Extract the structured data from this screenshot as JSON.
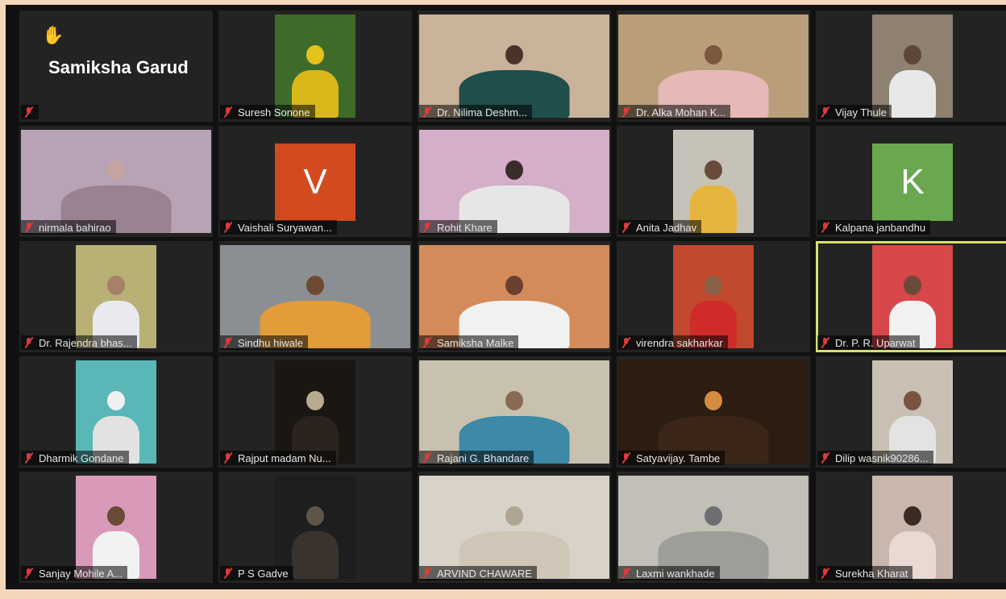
{
  "app": {
    "mic_state": "muted"
  },
  "highlight_color": "#d7e06b",
  "participants": [
    {
      "name": "",
      "big_name": "Samiksha Garud",
      "hand_raised": true,
      "type": "none",
      "active": false
    },
    {
      "name": "Suresh Sonone",
      "type": "video",
      "bg": "#3f6b2a",
      "fig": "#e2c21b",
      "body": "#d8b81a"
    },
    {
      "name": "Dr. Nilima Deshm...",
      "type": "video-wide",
      "bg": "#c9b39a",
      "fig": "#4a332a",
      "body": "#1f4e4b"
    },
    {
      "name": "Dr. Alka Mohan K...",
      "type": "video-wide",
      "bg": "#b89f7a",
      "fig": "#7a5840",
      "body": "#e7b8b8"
    },
    {
      "name": "Vijay Thule",
      "type": "video",
      "bg": "#8e8170",
      "fig": "#5e4636",
      "body": "#e8e8e8"
    },
    {
      "name": "nirmala bahirao",
      "type": "video-wide",
      "bg": "#b7a3b5",
      "fig": "#c6a4a2",
      "body": "#9a8292"
    },
    {
      "name": "Vaishali Suryawan...",
      "type": "avatar",
      "letter": "V",
      "color": "#d24a1e"
    },
    {
      "name": "Rohit Khare",
      "type": "video-wide",
      "bg": "#d5aec9",
      "fig": "#3a2c2a",
      "body": "#e6e6e6"
    },
    {
      "name": "Anita Jadhav",
      "type": "video",
      "bg": "#c7c2b7",
      "fig": "#6a4b3b",
      "body": "#e5b43c"
    },
    {
      "name": "Kalpana janbandhu",
      "type": "avatar",
      "letter": "K",
      "color": "#6aa84f"
    },
    {
      "name": "Dr. Rajendra bhas...",
      "type": "video",
      "bg": "#b8b075",
      "fig": "#a68067",
      "body": "#e9e9ef"
    },
    {
      "name": "Sindhu hiwale",
      "type": "video-wide",
      "bg": "#8b8f93",
      "fig": "#6e4a32",
      "body": "#e29c3a"
    },
    {
      "name": "Samiksha Malke",
      "type": "video-wide",
      "bg": "#d48b59",
      "fig": "#6a4030",
      "body": "#f1f1f1"
    },
    {
      "name": "virendra sakharkar",
      "type": "video",
      "bg": "#c0492e",
      "fig": "#8a6148",
      "body": "#cf2b2b"
    },
    {
      "name": "Dr. P. R. Uparwat",
      "type": "video",
      "bg": "#d8474a",
      "fig": "#6b4a37",
      "body": "#f2f2f2",
      "active": true
    },
    {
      "name": "Dharmik Gondane",
      "type": "video",
      "bg": "#5ab7b8",
      "fig": "#f0f0f0",
      "body": "#e2e2e2"
    },
    {
      "name": "Rajput madam Nu...",
      "type": "video",
      "bg": "#1a1612",
      "fig": "#b8aa91",
      "body": "#2b241e"
    },
    {
      "name": "Rajani G. Bhandare",
      "type": "video-wide",
      "bg": "#c9c1b0",
      "fig": "#8a6a55",
      "body": "#3c8aa6"
    },
    {
      "name": "Satyavijay. Tambe",
      "type": "video-wide",
      "bg": "#2c1c12",
      "fig": "#d48b40",
      "body": "#3a2518"
    },
    {
      "name": "Dilip wasnik90286...",
      "type": "video",
      "bg": "#c9c0b3",
      "fig": "#7a5440",
      "body": "#e3e3e3"
    },
    {
      "name": "Sanjay Mohile A...",
      "type": "video",
      "bg": "#d89ab8",
      "fig": "#6a4a38",
      "body": "#f2f2f2"
    },
    {
      "name": "P S Gadve",
      "type": "video",
      "bg": "#1e1e1e",
      "fig": "#5f5448",
      "body": "#3a332d"
    },
    {
      "name": "ARVIND CHAWARE",
      "type": "video-wide",
      "bg": "#d8d2c8",
      "fig": "#b0a494",
      "body": "#cfc6b8"
    },
    {
      "name": "Laxmi wankhade",
      "type": "video-wide",
      "bg": "#c2c0b6",
      "fig": "#6c6e73",
      "body": "#9d9e9a"
    },
    {
      "name": "Surekha Kharat",
      "type": "video",
      "bg": "#c9b7ad",
      "fig": "#3a2a24",
      "body": "#e8dad2"
    }
  ]
}
